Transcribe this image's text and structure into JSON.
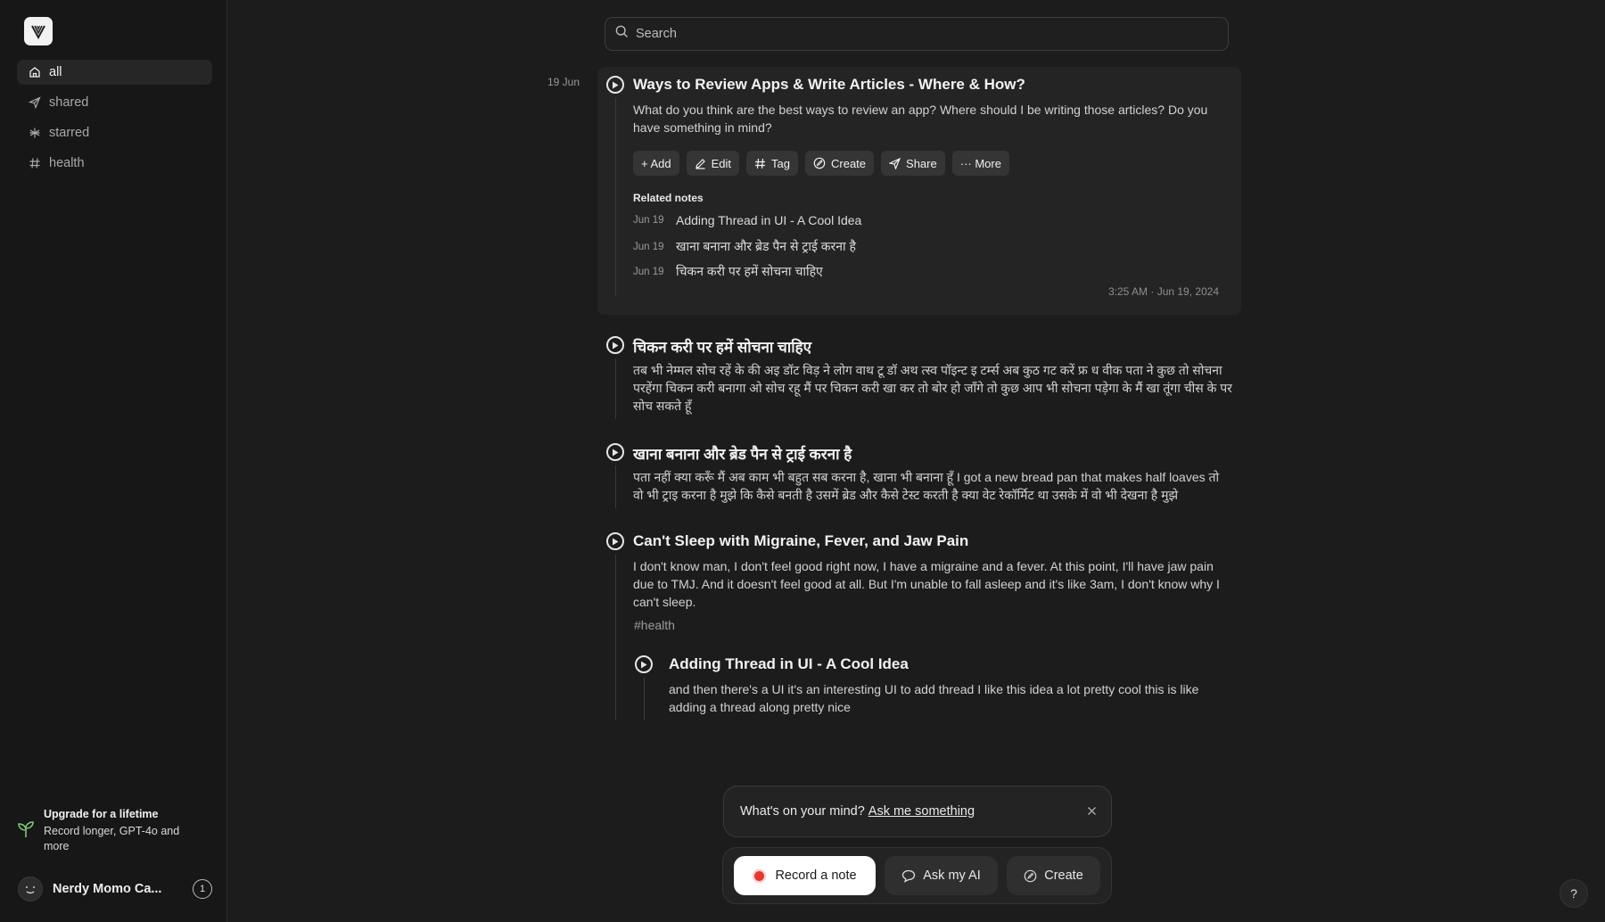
{
  "sidebar": {
    "nav": [
      {
        "label": "all",
        "icon": "home-icon",
        "active": true
      },
      {
        "label": "shared",
        "icon": "send-icon"
      },
      {
        "label": "starred",
        "icon": "asterisk-icon"
      },
      {
        "label": "health",
        "icon": "hash-icon"
      }
    ],
    "upgrade": {
      "title": "Upgrade for a lifetime",
      "text": "Record longer, GPT-4o and more"
    },
    "user": {
      "name": "Nerdy Momo Ca...",
      "badge": "1"
    }
  },
  "search": {
    "placeholder": "Search"
  },
  "feed": {
    "date_label": "19 Jun",
    "expanded_note": {
      "title": "Ways to Review Apps & Write Articles - Where & How?",
      "body": "What do you think are the best ways to review an app? Where should I be writing those articles? Do you have something in mind?",
      "actions": {
        "add": "+ Add",
        "edit": "Edit",
        "tag": "Tag",
        "create": "Create",
        "share": "Share",
        "more": "··· More"
      },
      "related_heading": "Related notes",
      "related": [
        {
          "date": "Jun 19",
          "title": "Adding Thread in UI - A Cool Idea"
        },
        {
          "date": "Jun 19",
          "title": "खाना बनाना और ब्रेड पैन से ट्राई करना है"
        },
        {
          "date": "Jun 19",
          "title": "चिकन करी पर हमें सोचना चाहिए"
        }
      ],
      "timestamp": "3:25 AM · Jun 19, 2024"
    },
    "notes": [
      {
        "title": "चिकन करी पर हमें सोचना चाहिए",
        "body": "तब भी नेम्मल सोच रहें के की अइ डॉट विड़ ने लोग वाथ टू डॉ अथ त्स्व पॉइन्ट इ टर्म्स अब कुठ गट करें फ्र ध वीक पता ने कुछ तो सोचना परहेंगा चिकन करी बनागा ओ सोच रहू मैं पर चिकन करी खा कर तो बोर हो जाँगे तो कुछ आप भी सोचना पड़ेगा के मैं खा तूंगा चीस के पर सोच सकते हूँ"
      },
      {
        "title": "खाना बनाना और ब्रेड पैन से ट्राई करना है",
        "body": "पता नहीं क्या करूँ मैं अब काम भी बहुत सब करना है, खाना भी बनाना हूँ I got a new bread pan that makes half loaves तो वो भी ट्राइ करना है मुझे कि कैसे बनती है उसमें ब्रेड और कैसे टेस्ट करती है क्या वेट रेकॉर्मिट था उसके में वो भी देखना है मुझे"
      },
      {
        "title": "Can't Sleep with Migraine, Fever, and Jaw Pain",
        "body": "I don't know man, I don't feel good right now, I have a migraine and a fever. At this point, I'll have jaw pain due to TMJ. And it doesn't feel good at all. But I'm unable to fall asleep and it's like 3am, I don't know why I can't sleep.",
        "tag": "health"
      },
      {
        "title": "Adding Thread in UI - A Cool Idea",
        "body": "and then there's a UI it's an interesting UI to add thread I like this idea a lot pretty cool this is like adding a thread along pretty nice"
      }
    ]
  },
  "prompt": {
    "text": "What's on your mind?",
    "link": "Ask me something"
  },
  "bottom_bar": {
    "record": "Record a note",
    "ask": "Ask my AI",
    "create": "Create"
  },
  "help": "?"
}
